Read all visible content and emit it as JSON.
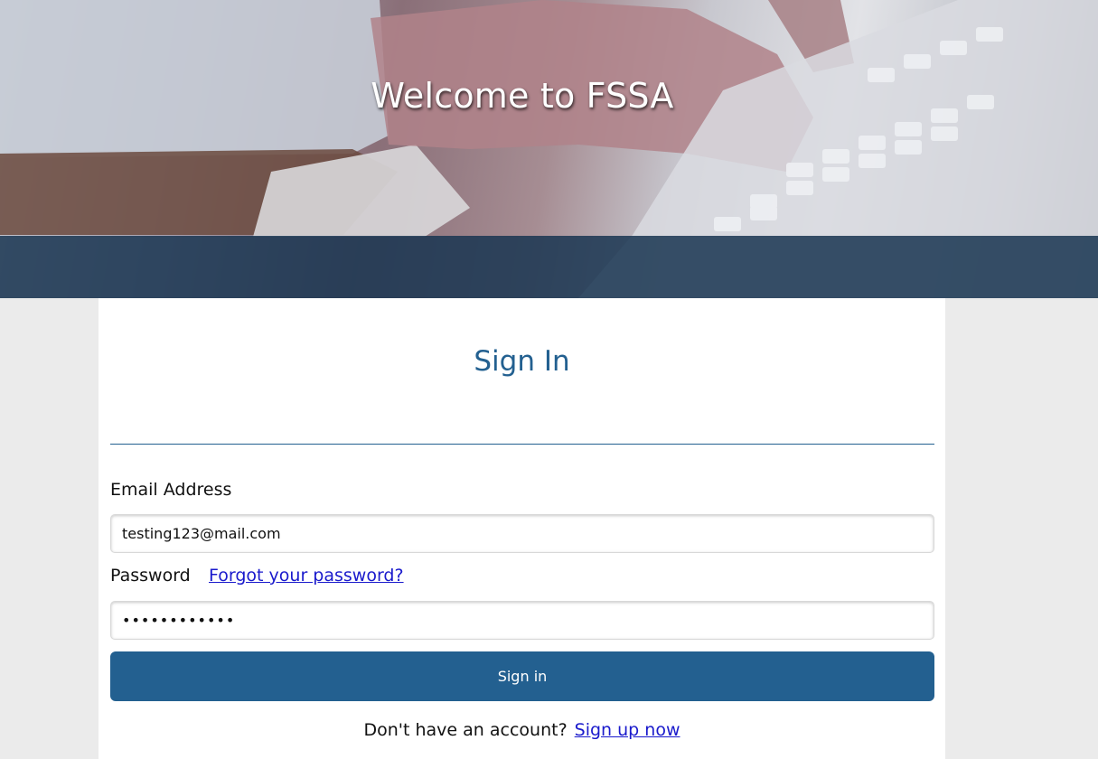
{
  "hero": {
    "title": "Welcome to FSSA"
  },
  "signin": {
    "title": "Sign In",
    "email_label": "Email Address",
    "email_value": "testing123@mail.com",
    "password_label": "Password",
    "forgot_link": "Forgot your password?",
    "password_value": "••••••••••••",
    "button_label": "Sign in",
    "no_account_text": "Don't have an account?",
    "signup_link": "Sign up now"
  },
  "colors": {
    "accent": "#236090",
    "band": "#1a3652",
    "link": "#1a1acc",
    "page_bg": "#ebebeb"
  }
}
